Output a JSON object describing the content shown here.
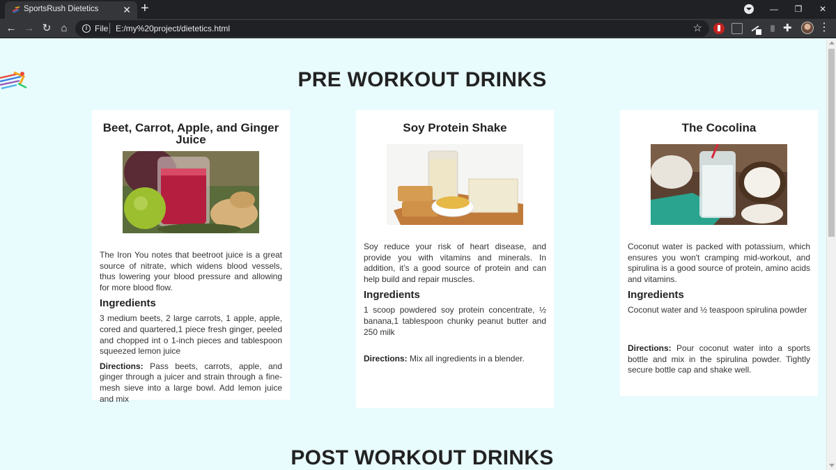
{
  "browser": {
    "tab_title": "SportsRush Dietetics",
    "new_tab_symbol": "+",
    "url_scheme": "File",
    "url": "E:/my%20project/dietetics.html"
  },
  "page": {
    "section_pre_title": "PRE WORKOUT DRINKS",
    "section_post_title": "POST WORKOUT DRINKS",
    "ingredients_heading": "Ingredients",
    "directions_label": "Directions:",
    "cards": [
      {
        "title": "Beet, Carrot, Apple, and Ginger Juice",
        "image": "beet-carrot-juice-image",
        "description": "The Iron You notes that beetroot juice is a great source of nitrate, which widens blood vessels, thus lowering your blood pressure and allowing for more blood flow.",
        "ingredients": "3 medium beets, 2 large carrots, 1 apple, apple, cored and quartered,1 piece fresh ginger, peeled and chopped int o 1-inch pieces and tablespoon squeezed lemon juice",
        "directions": "Pass beets, carrots, apple, and ginger through a juicer and strain through a fine-mesh sieve into a large bowl. Add lemon juice and mix"
      },
      {
        "title": "Soy Protein Shake",
        "image": "soy-protein-shake-image",
        "description": "Soy reduce your risk of heart disease, and provide you with vitamins and minerals. In addition, it’s a good source of protein and can help build and repair muscles.",
        "ingredients": "1 scoop powdered soy protein concentrate, ½ banana,1 tablespoon chunky peanut butter and 250 milk",
        "directions": "Mix all ingredients in a blender."
      },
      {
        "title": "The Cocolina",
        "image": "cocolina-image",
        "description": "Coconut water is packed with potassium, which ensures you won't cramping mid-workout, and spirulina is a good source of protein, amino acids and vitamins.",
        "ingredients": "Coconut water and ½ teaspoon spirulina powder",
        "directions": "Pour coconut water into a sports bottle and mix in the spirulina powder. Tightly secure bottle cap and shake well."
      }
    ]
  }
}
